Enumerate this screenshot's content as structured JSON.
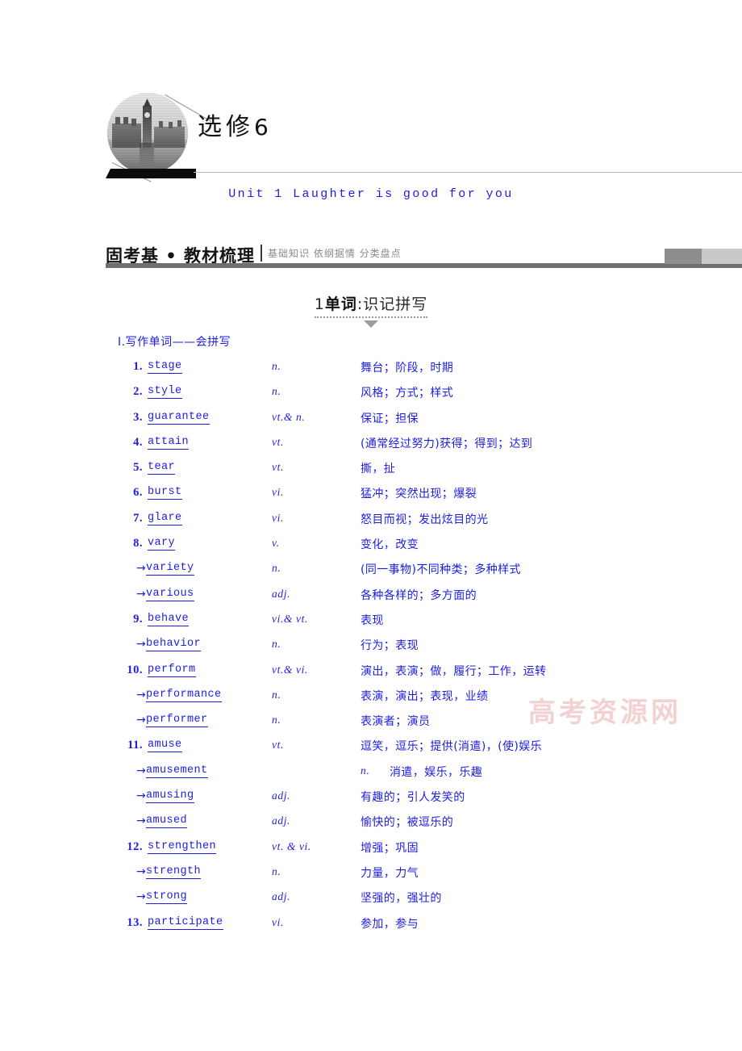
{
  "masthead": {
    "issue_label": "选修",
    "issue_number": "6",
    "logo_name": "big-ben-photo"
  },
  "unit_title": "Unit 1  Laughter is good for you",
  "band": {
    "title_bold": "固考基",
    "title_sep": " • ",
    "title_rest": "教材梳理",
    "subtitle": "基础知识 依纲据情 分类盘点"
  },
  "section": {
    "number": "1",
    "name": "单词",
    "colon": ":",
    "suffix": "识记拼写"
  },
  "list_label": "Ⅰ.写作单词——会拼写",
  "watermark": "高考资源网",
  "colors": {
    "text_blue": "#1d1de0",
    "band_gray": "#6f6f6f",
    "subtitle_gray": "#8a8a8a",
    "watermark_pink": "#f3c9c9"
  },
  "vocab": [
    {
      "index": "1.",
      "arrow": "",
      "word": "stage",
      "pos": "n.",
      "meaning": "舞台；阶段，时期"
    },
    {
      "index": "2.",
      "arrow": "",
      "word": "style",
      "pos": "n.",
      "meaning": "风格；方式；样式"
    },
    {
      "index": "3.",
      "arrow": "",
      "word": "guarantee",
      "pos": "vt.& n.",
      "meaning": "保证；担保"
    },
    {
      "index": "4.",
      "arrow": "",
      "word": "attain",
      "pos": "vt.",
      "meaning": "(通常经过努力)获得；得到；达到"
    },
    {
      "index": "5.",
      "arrow": "",
      "word": "tear",
      "pos": "vt.",
      "meaning": "撕，扯"
    },
    {
      "index": "6.",
      "arrow": "",
      "word": "burst",
      "pos": "vi.",
      "meaning": "猛冲；突然出现；爆裂"
    },
    {
      "index": "7.",
      "arrow": "",
      "word": "glare",
      "pos": "vi.",
      "meaning": "怒目而视；发出炫目的光"
    },
    {
      "index": "8.",
      "arrow": "",
      "word": "vary",
      "pos": "v.",
      "meaning": "变化，改变"
    },
    {
      "index": "",
      "arrow": "→",
      "word": "variety",
      "pos": "n.",
      "meaning": "(同一事物)不同种类；多种样式"
    },
    {
      "index": "",
      "arrow": "→",
      "word": "various",
      "pos": "adj.",
      "meaning": "各种各样的；多方面的"
    },
    {
      "index": "9.",
      "arrow": "",
      "word": "behave",
      "pos": "vi.& vt.",
      "meaning": "表现"
    },
    {
      "index": "",
      "arrow": "→",
      "word": "behavior",
      "pos": "n.",
      "meaning": "行为；表现"
    },
    {
      "index": "10.",
      "arrow": "",
      "word": "perform",
      "pos": "vt.& vi.",
      "meaning": "演出，表演；做，履行；工作，运转"
    },
    {
      "index": "",
      "arrow": "→",
      "word": "performance",
      "pos": "n.",
      "meaning": "表演，演出；表现，业绩"
    },
    {
      "index": "",
      "arrow": "→",
      "word": "performer",
      "pos": "n.",
      "meaning": "表演者；演员"
    },
    {
      "index": "11.",
      "arrow": "",
      "word": "amuse",
      "pos": "vt.",
      "meaning": "逗笑，逗乐；提供(消遣)，(使)娱乐"
    },
    {
      "index": "",
      "arrow": "→",
      "word": "amusement",
      "pos": "n.",
      "meaning": "消遣，娱乐，乐趣",
      "pos_shift": true
    },
    {
      "index": "",
      "arrow": "→",
      "word": "amusing",
      "pos": "adj.",
      "meaning": "有趣的；引人发笑的"
    },
    {
      "index": "",
      "arrow": "→",
      "word": "amused",
      "pos": "adj.",
      "meaning": "愉快的；被逗乐的"
    },
    {
      "index": "12.",
      "arrow": "",
      "word": "strengthen",
      "pos": "vt. & vi.",
      "meaning": "增强；巩固"
    },
    {
      "index": "",
      "arrow": "→",
      "word": "strength",
      "pos": "n.",
      "meaning": "力量，力气"
    },
    {
      "index": "",
      "arrow": "→",
      "word": "strong",
      "pos": "adj.",
      "meaning": "坚强的，强壮的"
    },
    {
      "index": "13.",
      "arrow": "",
      "word": "participate",
      "pos": "vi.",
      "meaning": "参加，参与"
    }
  ]
}
